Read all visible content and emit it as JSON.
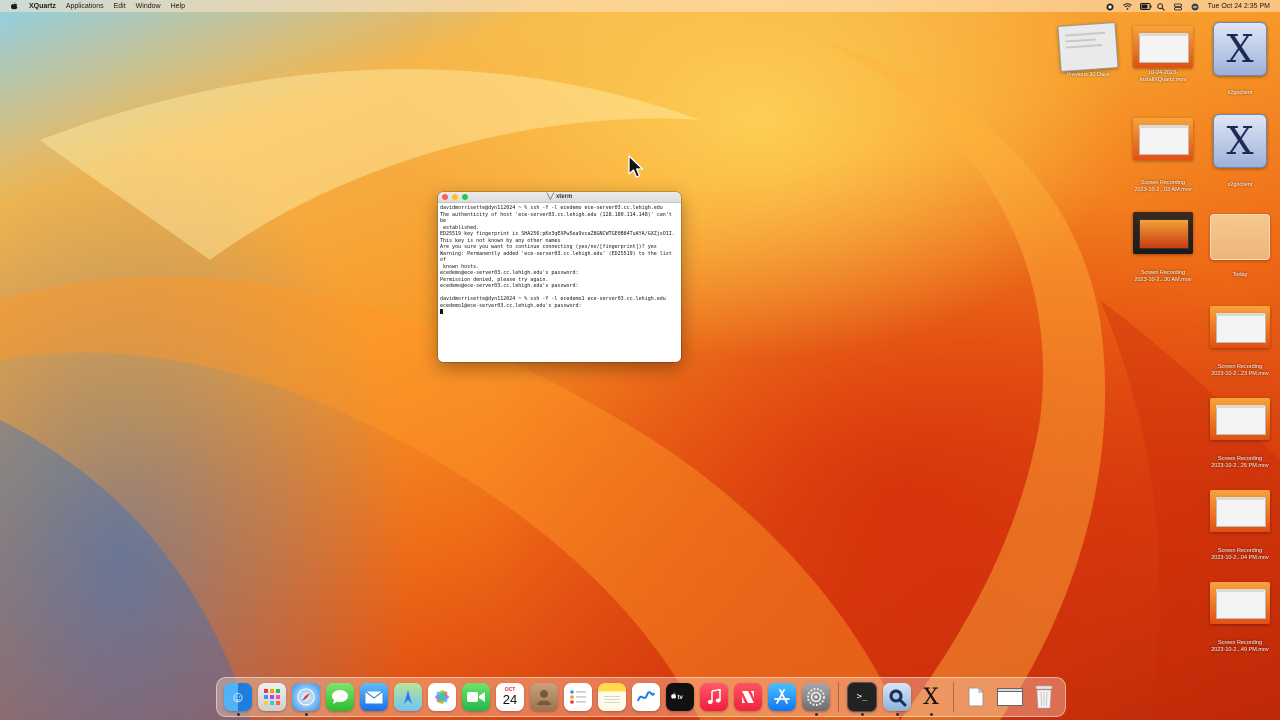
{
  "menubar": {
    "app_name": "XQuartz",
    "items": [
      "Applications",
      "Edit",
      "Window",
      "Help"
    ],
    "clock": "Tue Oct 24  2:35 PM"
  },
  "xterm": {
    "title": "xterm",
    "lines": [
      "davidmorrisette@dyn112024 ~ % ssh -Y -l ecedemo ece-server03.cc.lehigh.edu",
      "The authenticity of host 'ece-server03.cc.lehigh.edu (128.180.114.148)' can't be",
      " established.",
      "ED25519 key fingerprint is SHA256:pKn3qEXPw5ea9vcaZ8GNCWTGE0B84TuAYA/GXZjsO1I.",
      "This key is not known by any other names",
      "Are you sure you want to continue connecting (yes/no/[fingerprint])? yes",
      "Warning: Permanently added 'ece-server03.cc.lehigh.edu' (ED25519) to the list of",
      " known hosts.",
      "ecedemo@ece-server03.cc.lehigh.edu's password:",
      "Permission denied, please try again.",
      "ecedemo@ece-server03.cc.lehigh.edu's password:",
      "",
      "davidmorrisette@dyn112024 ~ % ssh -Y -l ecedemo1 ece-server03.cc.lehigh.edu",
      "ecedemo1@ece-server03.cc.lehigh.edu's password:"
    ]
  },
  "desktop_icons": [
    {
      "label": "Previous 30 Days",
      "icon": "stack-icon"
    },
    {
      "label": "10-24-2023-\nInstallXQuartz.mov",
      "icon": "video-thumbnail"
    },
    {
      "label": "x2goclient",
      "icon": "x11-app-icon"
    },
    {
      "label": "Screen Recording\n2023-10-2...03 AM.mov",
      "icon": "video-thumbnail"
    },
    {
      "label": "x2goclient",
      "icon": "x11-app-icon"
    },
    {
      "label": "Screen Recording\n2023-10-2...30 AM.mov",
      "icon": "video-thumbnail"
    },
    {
      "label": "Today",
      "icon": "stack-icon"
    },
    {
      "label": "Screen Recording\n2023-10-2...23 PM.mov",
      "icon": "video-thumbnail"
    },
    {
      "label": "Screen Recording\n2023-10-2...25 PM.mov",
      "icon": "video-thumbnail"
    },
    {
      "label": "Screen Recording\n2023-10-2...04 PM.mov",
      "icon": "video-thumbnail"
    },
    {
      "label": "Screen Recording\n2023-10-2...49 PM.mov",
      "icon": "video-thumbnail"
    }
  ],
  "dock": {
    "calendar_month": "OCT",
    "calendar_day": "24",
    "apps": [
      "finder-icon",
      "launchpad-icon",
      "safari-icon",
      "messages-icon",
      "mail-icon",
      "maps-icon",
      "photos-icon",
      "facetime-icon",
      "calendar-icon",
      "contacts-icon",
      "reminders-icon",
      "notes-icon",
      "freeform-icon",
      "tv-icon",
      "music-icon",
      "news-icon",
      "app-store-icon",
      "system-settings-icon",
      "terminal-icon",
      "quicktime-icon",
      "xquartz-icon",
      "document-icon",
      "window-icon",
      "trash-icon"
    ]
  },
  "colors": {
    "accent_orange": "#f79a2a",
    "traffic_red": "#fe5f57",
    "traffic_yellow": "#febc2e",
    "traffic_green": "#28c840"
  }
}
